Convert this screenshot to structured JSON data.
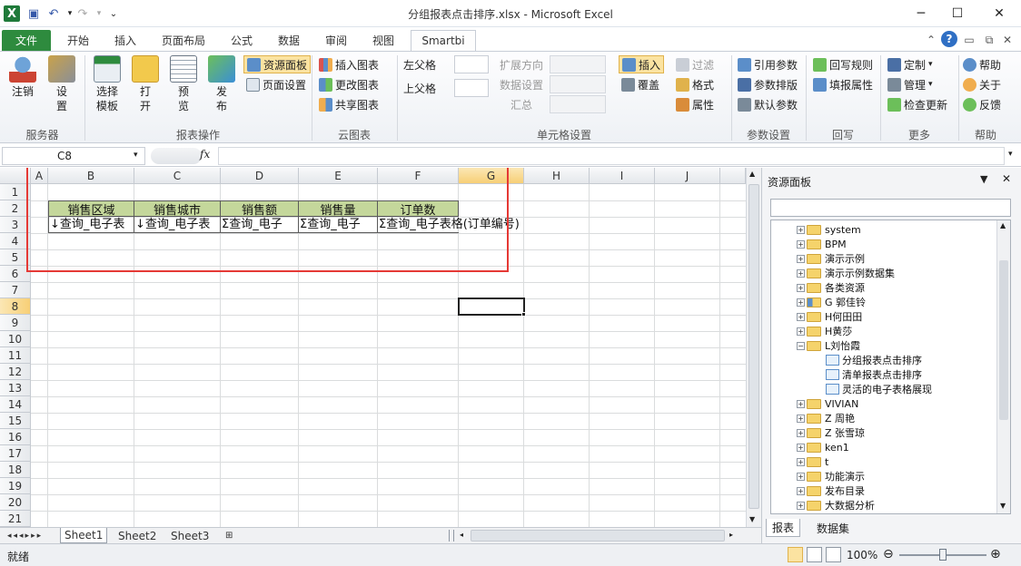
{
  "window": {
    "title": "分组报表点击排序.xlsx - Microsoft Excel"
  },
  "qat": {
    "excel": "excel-logo-icon",
    "save": "save-icon",
    "undo": "undo-icon",
    "redo": "redo-icon",
    "customize": "customize-qat-icon"
  },
  "tabs": [
    "文件",
    "开始",
    "插入",
    "页面布局",
    "公式",
    "数据",
    "审阅",
    "视图",
    "Smartbi"
  ],
  "ribbon": {
    "groups": {
      "service": "服务器",
      "report_ops": "报表操作",
      "cloud_chart": "云图表",
      "cell_settings": "单元格设置",
      "param_settings": "参数设置",
      "writeback": "回写",
      "more": "更多",
      "help": "帮助"
    },
    "service": {
      "logout": "注销",
      "settings": "设\n置"
    },
    "report_ops": {
      "select_template": "选择\n模板",
      "open": "打\n开",
      "preview": "预\n览",
      "publish": "发\n布",
      "resource_panel": "资源面板",
      "page_setup": "页面设置"
    },
    "cloud_chart": {
      "insert_chart": "插入图表",
      "change_chart": "更改图表",
      "share_chart": "共享图表"
    },
    "cell": {
      "left_parent": "左父格",
      "top_parent": "上父格",
      "expand_dir": "扩展方向",
      "data_settings": "数据设置",
      "summary": "汇总",
      "insert": "插入",
      "overwrite": "覆盖",
      "filter": "过滤",
      "format": "格式",
      "property": "属性"
    },
    "param": {
      "ref_param": "引用参数",
      "param_layout": "参数排版",
      "default_param": "默认参数"
    },
    "writeback": {
      "rule": "回写规则",
      "fill_property": "填报属性"
    },
    "more": {
      "custom": "定制",
      "manage": "管理",
      "check_update": "检查更新"
    },
    "help": {
      "help": "帮助",
      "about": "关于",
      "feedback": "反馈"
    }
  },
  "formula": {
    "namebox": "C8",
    "fx": "fx"
  },
  "columns": [
    "A",
    "B",
    "C",
    "D",
    "E",
    "F",
    "G",
    "H",
    "I",
    "J"
  ],
  "rows": [
    "1",
    "2",
    "3",
    "4",
    "5",
    "6",
    "7",
    "8",
    "9",
    "10",
    "11",
    "12",
    "13",
    "14",
    "15",
    "16",
    "17",
    "18",
    "19",
    "20",
    "21"
  ],
  "headers": [
    "销售区域",
    "销售城市",
    "销售额",
    "销售量",
    "订单数"
  ],
  "data_row": [
    "↓查询_电子表格(销售区域)",
    "↓查询_电子表格(销售城市)",
    "Σ查询_电子表格(销售额)",
    "Σ查询_电子表格(销售量)",
    "Σ查询_电子表格(订单编号)"
  ],
  "data_row_visible": [
    "↓查询_电子表",
    "↓查询_电子表",
    "Σ查询_电子",
    "Σ查询_电子",
    "Σ查询_电子表格(订单编号)"
  ],
  "sheets": [
    "Sheet1",
    "Sheet2",
    "Sheet3"
  ],
  "panel": {
    "title": "资源面板",
    "tree": [
      {
        "label": "system",
        "type": "folder",
        "level": 0
      },
      {
        "label": "BPM",
        "type": "folder",
        "level": 0
      },
      {
        "label": "演示示例",
        "type": "folder",
        "level": 0
      },
      {
        "label": "演示示例数据集",
        "type": "folder",
        "level": 0
      },
      {
        "label": "各类资源",
        "type": "folder",
        "level": 0
      },
      {
        "label": "G 郭佳铃",
        "type": "folder",
        "level": 0
      },
      {
        "label": "H何田田",
        "type": "folder",
        "level": 0
      },
      {
        "label": "H黄莎",
        "type": "folder",
        "level": 0
      },
      {
        "label": "L刘怡霞",
        "type": "folder",
        "level": 0,
        "expanded": true
      },
      {
        "label": "分组报表点击排序",
        "type": "report",
        "level": 1
      },
      {
        "label": "清单报表点击排序",
        "type": "report",
        "level": 1
      },
      {
        "label": "灵活的电子表格展现",
        "type": "report",
        "level": 1
      },
      {
        "label": "VIVIAN",
        "type": "folder",
        "level": 0
      },
      {
        "label": "Z 周艳",
        "type": "folder",
        "level": 0
      },
      {
        "label": "Z 张雪琼",
        "type": "folder",
        "level": 0
      },
      {
        "label": "ken1",
        "type": "folder",
        "level": 0
      },
      {
        "label": "t",
        "type": "folder",
        "level": 0
      },
      {
        "label": "功能演示",
        "type": "folder",
        "level": 0
      },
      {
        "label": "发布目录",
        "type": "folder",
        "level": 0
      },
      {
        "label": "大数据分析",
        "type": "folder",
        "level": 0
      }
    ],
    "bottom_tabs": [
      "报表",
      "数据集"
    ]
  },
  "status": {
    "ready": "就绪",
    "zoom": "100%"
  },
  "colors": {
    "file_tab": "#2e8b3e",
    "header_fill": "#c4d79b",
    "highlight_box": "#e53935"
  }
}
